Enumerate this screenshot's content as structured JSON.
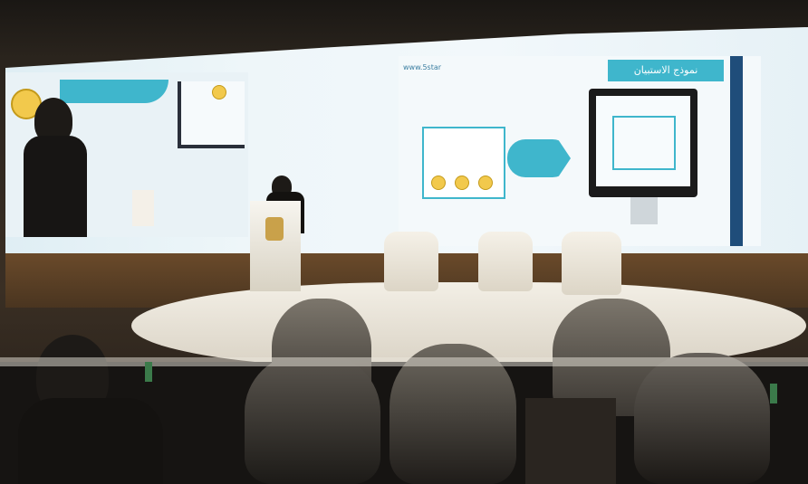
{
  "slide": {
    "title": "نموذج الاستبيان",
    "logo_text": "www.5star"
  },
  "colors": {
    "screen": "#eef6f9",
    "accent_teal": "#3fb6cc",
    "stage": "#efe9dd",
    "audience": "#1d1a17"
  }
}
